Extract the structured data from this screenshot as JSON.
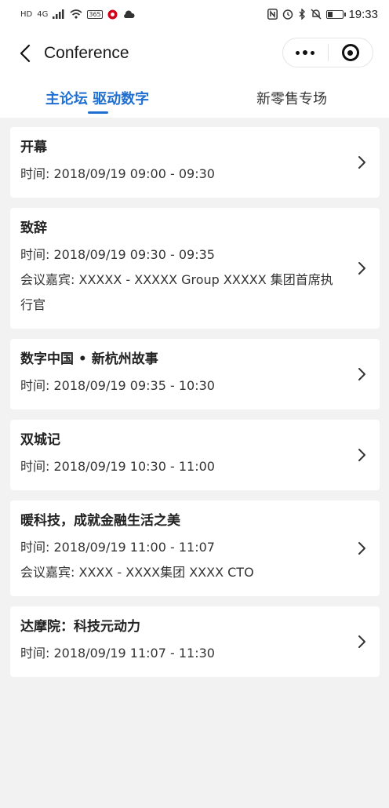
{
  "status_bar": {
    "left_icons": [
      "HD",
      "4G",
      "signal-icon",
      "wifi-icon",
      "365",
      "app-notification-icon",
      "cloud-icon"
    ],
    "right_icons": [
      "nfc-icon",
      "alarm-icon",
      "bluetooth-icon",
      "mute-icon",
      "battery-icon"
    ],
    "hd": "HD",
    "net": "4G",
    "app365": "365",
    "time": "19:33",
    "battery_level": 0.3
  },
  "navbar": {
    "title": "Conference",
    "back_icon": "chevron-left-icon",
    "more_icon": "more-dots-icon",
    "close_icon": "target-circle-icon"
  },
  "tabs": [
    {
      "label": "主论坛 驱动数字",
      "active": true
    },
    {
      "label": "新零售专场",
      "active": false
    }
  ],
  "accent_color": "#1f6fd1",
  "sessions": [
    {
      "title": "开幕",
      "time": "时间: 2018/09/19 09:00 - 09:30",
      "guest": ""
    },
    {
      "title": "致辞",
      "time": "时间: 2018/09/19 09:30 - 09:35",
      "guest": "会议嘉宾: XXXXX - XXXXX Group XXXXX 集团首席执行官"
    },
    {
      "title": "数字中国 • 新杭州故事",
      "time": "时间: 2018/09/19 09:35 - 10:30",
      "guest": ""
    },
    {
      "title": "双城记",
      "time": "时间: 2018/09/19 10:30 - 11:00",
      "guest": ""
    },
    {
      "title": "暖科技，成就金融生活之美",
      "time": "时间: 2018/09/19 11:00 - 11:07",
      "guest": "会议嘉宾: XXXX - XXXX集团 XXXX CTO"
    },
    {
      "title": "达摩院：科技元动力",
      "time": "时间: 2018/09/19 11:07 - 11:30",
      "guest": ""
    }
  ]
}
